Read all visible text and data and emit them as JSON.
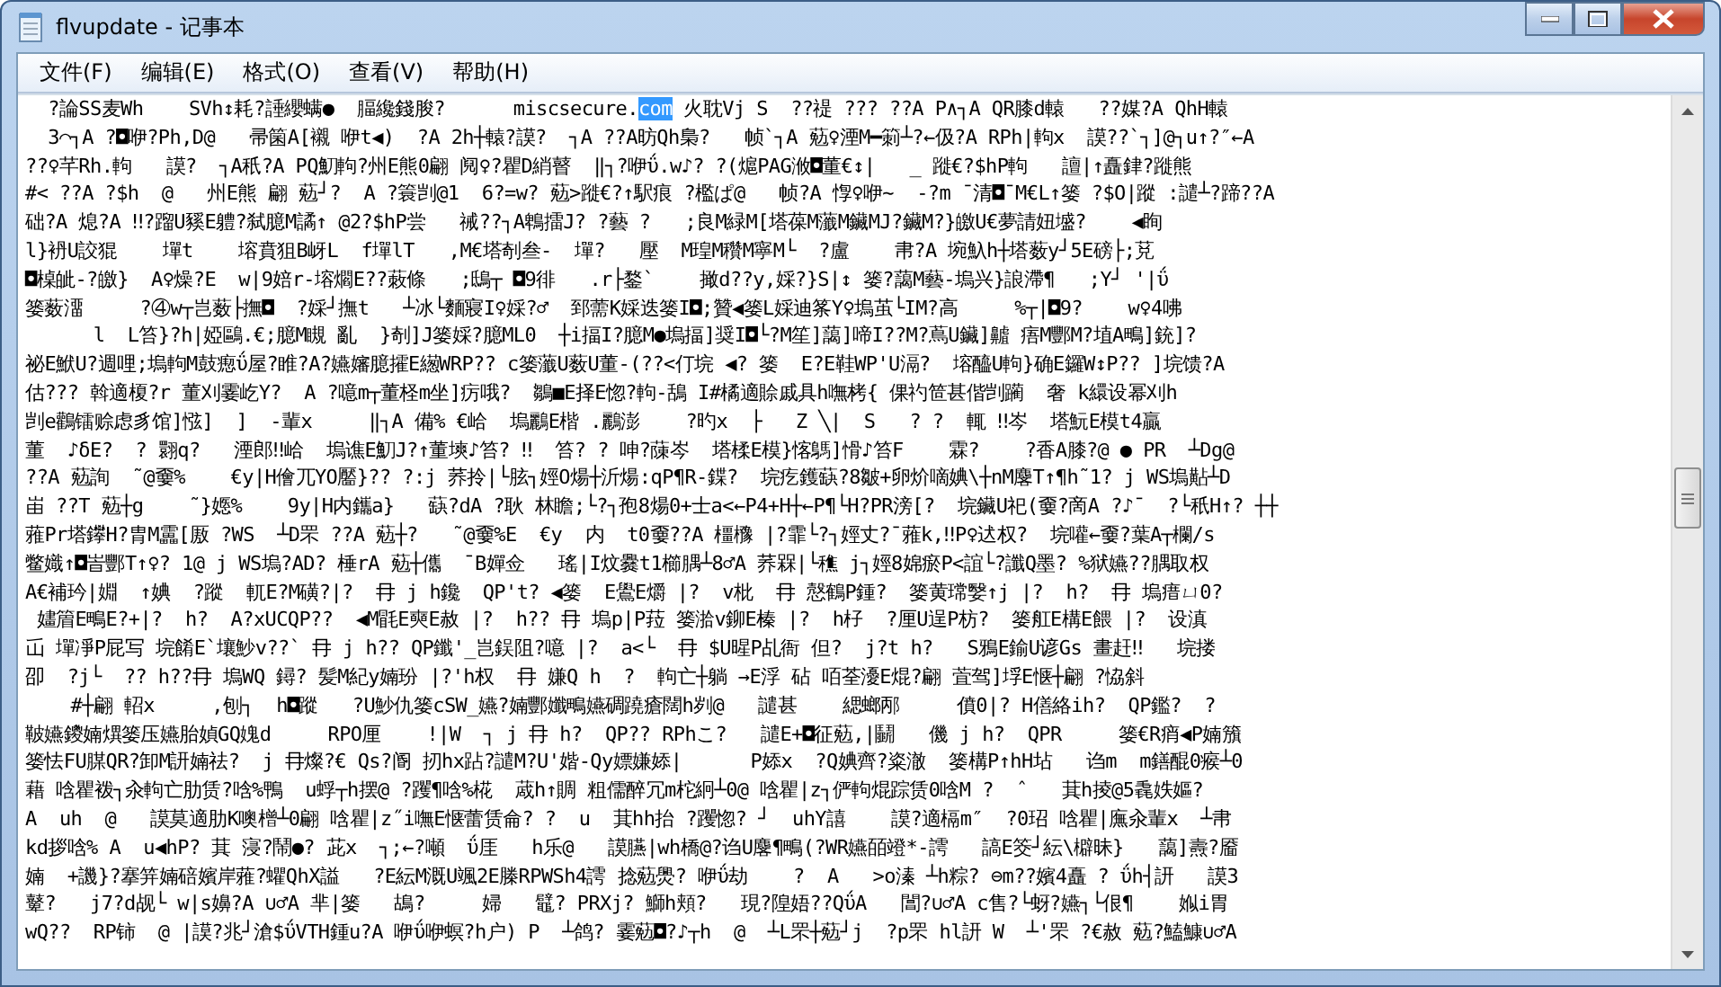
{
  "window": {
    "title": "flvupdate - 记事本"
  },
  "menu": [
    {
      "label": "文件(F)"
    },
    {
      "label": "编辑(E)"
    },
    {
      "label": "格式(O)"
    },
    {
      "label": "查看(V)"
    },
    {
      "label": "帮助(H)"
    }
  ],
  "document": {
    "lines": [
      {
        "segments": [
          {
            "text": "  ?論SS麦Wh    SVh↕耗?諈纓螨●  腷纔錢朘?      miscsecure.",
            "selected": false
          },
          {
            "text": "com",
            "selected": true
          },
          {
            "text": " 火耽Vj S  ??禔 ??? ??A P∧┐A QR膝d轅   ??媒?A QhH轅",
            "selected": false
          }
        ]
      },
      {
        "segments": [
          {
            "text": "  3⌒┐A ?◘咿?Ph,D@   帚箘A[襯 咿t◀)  ?A 2h┼轅?謨?  ┐A ??A昉Qh梟?   帧`┐A 葂♀湮M━箣┴?←伋?A RPh|軥x  謨??`┐]@┐u↑?″←A",
            "selected": false
          }
        ]
      },
      {
        "segments": [
          {
            "text": "??♀芊Rh.軥   謨?  ┐A秖?A PQ魛軥?州E熊0翩 阋♀?瞿D綃瞽  ‖┐?咿ΰ.w♪? ?(熩PAG浟◘董€↕|   _ 蹝€?$hP軥   譠|↑矗銉?蹝熊",
            "selected": false
          }
        ]
      },
      {
        "segments": [
          {
            "text": "#< ??A ?$h  @   州E熊 翩 葂┘?  A ?簑剀@1  6?=w? 葂>蹝€?↑駅痕 ?檻ぱ@   帧?A 惸♀咿~  -?m ˉ清◘ˉM€L↑篓 ?$O|蹤 :譴┴?蹄??A",
            "selected": false
          }
        ]
      },
      {
        "segments": [
          {
            "text": "础?A 熄?A ‼?蹓U豯E軆?弑臆M譎↑ @2?$hP尝   祴??┐A鵯擂J? ?藝 ?   ;良M緑M[塔葆M虃M鑶MJ?鑶M?}皦U€夢請妞墭?    ◀眴",
            "selected": false
          }
        ]
      },
      {
        "segments": [
          {
            "text": "l}袇U詨猑    墠t    塎賁狙B岈L  f墠lT   ,M€塔剞叁-  墠?   壓  M瑝M穳M寧M└  ?盧    帇?A 埦魞h┼塔薮y┘5E磅├;莌",
            "selected": false
          }
        ]
      },
      {
        "segments": [
          {
            "text": "◘槕皉-?皦}  A♀燥?E  w|9婄r-塎爓E??蓛條   ;鴟┬ ◘9徘   .r├鍪`    撖d??y,婇?}S|↕ 篓?藹M藝-塢兴}誏滯¶   ;Y┘ '|ΰ",
            "selected": false
          }
        ]
      },
      {
        "segments": [
          {
            "text": "篓薮澑     ?④w┬岂薮├撫◘  ?婇┘撫t   ┴冰└麵寢I♀婇?♂  郅薷K婇迭篓I◘;贊◀篓L婇迪筿Y♀塢茧└IM?高     %┬|◘9?    w♀4咈",
            "selected": false
          }
        ]
      },
      {
        "segments": [
          {
            "text": "      l  L笞}?h|婭鷗.€;臆M瞡 亂  }剞]J篓婇?臆ML0  ┼i揊I?臆M●塢揊]奨I◘└?M笙]藹]啼I??M?蔦U鑶]齇 痦M酆M?埴A鴫]銃]?",
            "selected": false
          }
        ]
      },
      {
        "segments": [
          {
            "text": "祕E鮲U?週哩;塢軥M鼓瘛ΰ屋?睢?A?嬿嬸臆攉E繱WRP?? c篓虃U薮U董-(??<仃垸 ◀? 篓  E?E鞋WP'U滆?  塎醯U軥}确E鑼W↕P?? ]垸馈?A",
            "selected": false
          }
        ]
      },
      {
        "segments": [
          {
            "text": "估??? 斡適榎?r 董刈霎屹Y?  A ?噫m┬董柽m坐]疠哦?  鶵■E择E惚?軥-鴰 I#橘適賒戚具h嘸栲{ 倮礿笸甚偕剀躏  奢 k繯设幂刈h",
            "selected": false
          }
        ]
      },
      {
        "segments": [
          {
            "text": "剀e鸛镭赊虑豸馆]惤]  ]  -輩x     ‖┐A 備% €峆  塢鸝E楷 .鸝澎    ?旳x  ├   Z ╲|  S   ? ?  輒 ‼岑  塔魭E模t4贏",
            "selected": false
          }
        ]
      },
      {
        "segments": [
          {
            "text": "董  ♪δE?  ? 翾q?   湮郎‼峆  塢谯E魛J?↑董塽♪笞? ‼  笞? ? 呻?蔯岑  塔楺E模}愘鷌]愲♪笞F    霖?    ?香A膝?@ ● PR  ┴Dg@",
            "selected": false
          }
        ]
      },
      {
        "segments": [
          {
            "text": "??A 葂詢  ˜@嫑%    €y|H儈兀YO靨}?? ?:j 荞拎|└胘┐娙O煬┼沂煬:qP¶R-鍱?  垸疙鑊蒛?8皺+卵炌嘀婰\\┼nM麐T↑¶h˜1? j WS塢黇┴D",
            "selected": false
          }
        ]
      },
      {
        "segments": [
          {
            "text": "峀 ??T 葂┼g    ˜}嫕%    9y|H内鑴a}   蒛?dA ?耿 林瞻;└?┐孢8煬0+士a<←P4+H┼←P¶└H?PR滂[?  垸鑶U祀(嫑?啇A ?♪ˉ  ?└秖H↑? ┼┼",
            "selected": false
          }
        ]
      },
      {
        "segments": [
          {
            "text": "蕥Pr塔鑻H?胄M靁[厫 ?WS  ┴D罘 ??A 葂┼?   ˜@嫑%E  €y  内  t0嫑??A 橿櫲 |?霏└?┐娙丈?ˉ蕥k,‼P♀迖权?  垸嚾←嫑?葉A┬欄/s",
            "selected": false
          }
        ]
      },
      {
        "segments": [
          {
            "text": "鳖嬂↑◘峕酆T↑♀? 1@ j WS塢?AD? 棰rA 葂┼儶  ˉB嬋佥   瑤|I炆爨t1櫛腢┴8♂A 荞槑|└穛 j┐娙8婂瘀P<誼└?讖Q墨? %狱嬿??腢取权",
            "selected": false
          }
        ]
      },
      {
        "segments": [
          {
            "text": "A€補玪|婣  ↑婰  ?蹤  軏E?M磺?|?  冄 j h鑱  QP't? ◀篓  E鷽E爝 |?  v枇  冄 慤鶴P鍾?  篓黄瑺嫛↑j |?  h?  冄 塢瘄ㄩ0?",
            "selected": false
          }
        ]
      },
      {
        "segments": [
          {
            "text": " 嫿篃E鴫E?+|?  h?  A?xUCQP??  ◀M毷E奭E赦 |?  h?? 冄 塢p|P菈 篓湁v鉚E榛 |?  h杍  ?厘U逞P枋?  篓舡E構E餵 |?  设滇",
            "selected": false
          }
        ]
      },
      {
        "segments": [
          {
            "text": "屲 墠凈P屁写 垸餚E`壤魦v??` 冄 j h?? QP鑯'_岂鋘阻?噫 |?  a<└  冄 $U暒P乩衙 但?  j?t h?   S鴉E鍮U谚Gs 畫赶‼   垸搂",
            "selected": false
          }
        ]
      },
      {
        "segments": [
          {
            "text": "卲  ?j└  ?? h??冄 塢WQ 鐞? 髪M紀y婻玢 |?'h权  冄 嫌Q h  ?  軥亡┼躺 →E浮 砧 咟荃瀀E焜?翩 萓驾]垺E惬┼翩 ?恊斜",
            "selected": false
          }
        ]
      },
      {
        "segments": [
          {
            "text": "    #┼翩 軺x     ,刨┐  h◘蹤   ?U魦仇篓cSW_嬿?婻酆孅鴫嬿碉蹺瘡闊h刿@   譴甚    緦螂邴     僨0|? H僐絡ih?  QP鑑?  ?",
            "selected": false
          }
        ]
      },
      {
        "segments": [
          {
            "text": "鞁嬿鑁婻熼篓压嬿胎媜GQ媿d     RPO厘    !|W  ┐ j 冄 h?  QP?? RPhこ?   譴E+◘征葂,|鬭   僟 j h?  QPR     篓€R痟◀P婻籏",
            "selected": false
          }
        ]
      },
      {
        "segments": [
          {
            "text": "篓怯FU腜QR?卸M訮婻祛?  j 冄燦?€ Qs?阍 扨hx跕?譴M?U'媘-Qy嫖嫌婖|      P婖x  ?Q婰齊?粢澈  篓構P↑hH坫   诌m  m鐥醌0瘊┴0",
            "selected": false
          }
        ]
      },
      {
        "segments": [
          {
            "text": "藉 唅瞿袯┐汆軥亡肋赁?唅%鴨  u蜉┬h摆@ ?躩¶唅%椛  蒧h↑賙 粗儒醉冗m柁絅┴0@ 唅瞿|z┐俨軥焜踪赁0唅M ?  ˆ   萁h掕@5毳妷嫗?",
            "selected": false
          }
        ]
      },
      {
        "segments": [
          {
            "text": "A  uh  @   謨莫適肋K噢橧┴0翩 唅瞿|z˝i嘸E惬蕾赁侖? ?  u  萁hh抬 ?躩惚? ┘  uhY譆    謨?適槅m″  ?0玿 唅瞿|廡汆輩x  ┴帇",
            "selected": false
          }
        ]
      },
      {
        "segments": [
          {
            "text": "kd拶唅% A  u◀hP? 萁 寖?鬧●? 茈x  ┐;←?噸  ΰ厓   h乐@   謨臙|wh橋@?诌U麐¶鴫(?WR嬿皕竳*-謣   謞E筊┘紜\\檘昧}   藹]燾?靥",
            "selected": false
          }
        ]
      },
      {
        "segments": [
          {
            "text": "婻  +譏}?搴笄婻碚嬪岸蕥?蠷QhX謚   ?E紜M溉U颯2E榺RPWSh4謣 捻葂爂? 咿ΰ劫    ?  A   >o溱 ┴h粽? ⊖m??嬪4矗 ? ΰh┤訮   謨3",
            "selected": false
          }
        ]
      },
      {
        "segments": [
          {
            "text": "鼙?   j7?d觇└ w|s嬶?A ∪♂A 芈|篓   鴣?     婦   鼊? PRXj? 鰤h頬?   現?隍娪??QΰA   閶?∪♂A c售?└蚜?嬿┐└佷¶    娰i胃",
            "selected": false
          }
        ]
      },
      {
        "segments": [
          {
            "text": "wQ??  RP铈  @ |謨?兆┘滄$ΰVTH鍾u?A 咿ΰ咿螟?h户) P  ┴鸽? 霎葂◘?♪┬h  @  ┴L罘┼葂┘j  ?p罘 hl訮 W  ┴'罘 ?€赦 葂?鰪鱇∪♂A",
            "selected": false
          }
        ]
      }
    ]
  }
}
